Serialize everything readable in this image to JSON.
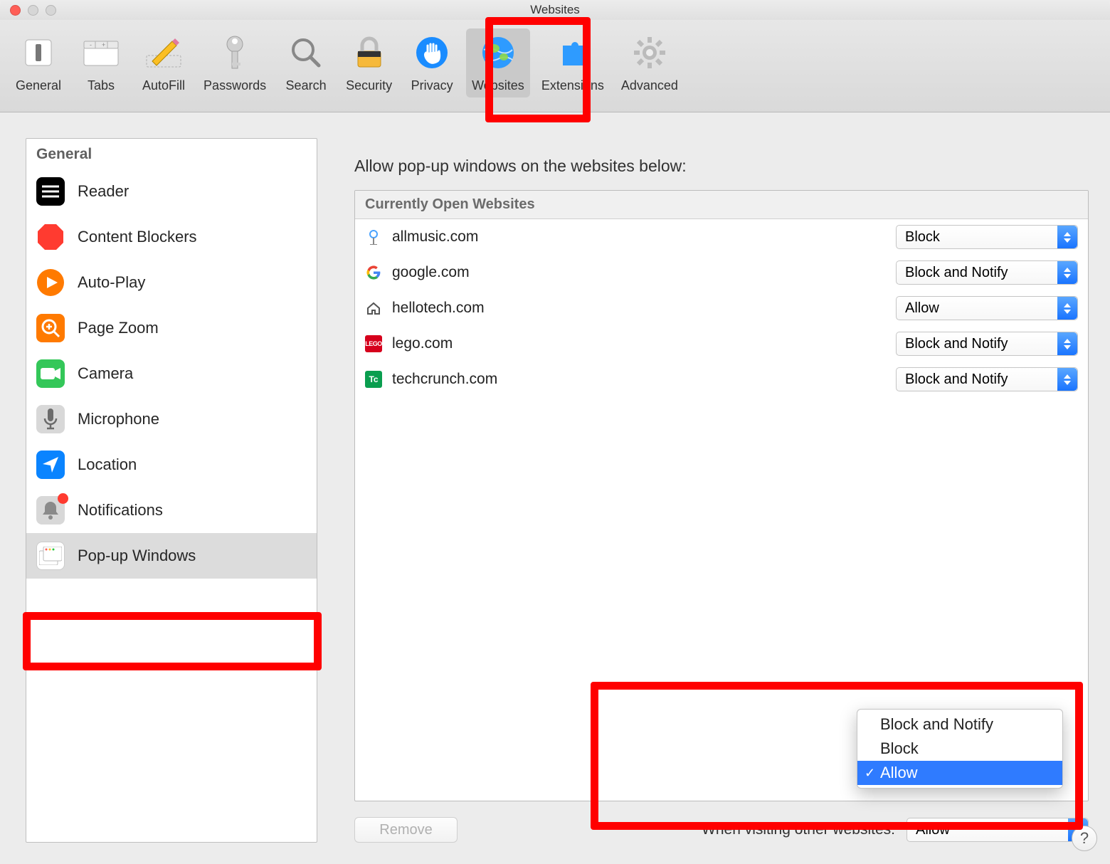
{
  "window": {
    "title": "Websites"
  },
  "toolbar": {
    "items": [
      {
        "id": "general",
        "label": "General"
      },
      {
        "id": "tabs",
        "label": "Tabs"
      },
      {
        "id": "autofill",
        "label": "AutoFill"
      },
      {
        "id": "passwords",
        "label": "Passwords"
      },
      {
        "id": "search",
        "label": "Search"
      },
      {
        "id": "security",
        "label": "Security"
      },
      {
        "id": "privacy",
        "label": "Privacy"
      },
      {
        "id": "websites",
        "label": "Websites"
      },
      {
        "id": "extensions",
        "label": "Extensions"
      },
      {
        "id": "advanced",
        "label": "Advanced"
      }
    ],
    "selected": "websites"
  },
  "sidebar": {
    "section_title": "General",
    "items": [
      {
        "id": "reader",
        "label": "Reader"
      },
      {
        "id": "content-blockers",
        "label": "Content Blockers"
      },
      {
        "id": "auto-play",
        "label": "Auto-Play"
      },
      {
        "id": "page-zoom",
        "label": "Page Zoom"
      },
      {
        "id": "camera",
        "label": "Camera"
      },
      {
        "id": "microphone",
        "label": "Microphone"
      },
      {
        "id": "location",
        "label": "Location"
      },
      {
        "id": "notifications",
        "label": "Notifications",
        "badge": true
      },
      {
        "id": "popup-windows",
        "label": "Pop-up Windows"
      }
    ],
    "selected": "popup-windows"
  },
  "main": {
    "heading": "Allow pop-up windows on the websites below:",
    "group_header": "Currently Open Websites",
    "sites": [
      {
        "domain": "allmusic.com",
        "setting": "Block"
      },
      {
        "domain": "google.com",
        "setting": "Block and Notify"
      },
      {
        "domain": "hellotech.com",
        "setting": "Allow"
      },
      {
        "domain": "lego.com",
        "setting": "Block and Notify"
      },
      {
        "domain": "techcrunch.com",
        "setting": "Block and Notify"
      }
    ],
    "remove_label": "Remove",
    "other_websites_label": "When visiting other websites:",
    "other_websites_value": "Allow",
    "menu_options": [
      "Block and Notify",
      "Block",
      "Allow"
    ],
    "menu_selected": "Allow"
  },
  "help_glyph": "?"
}
